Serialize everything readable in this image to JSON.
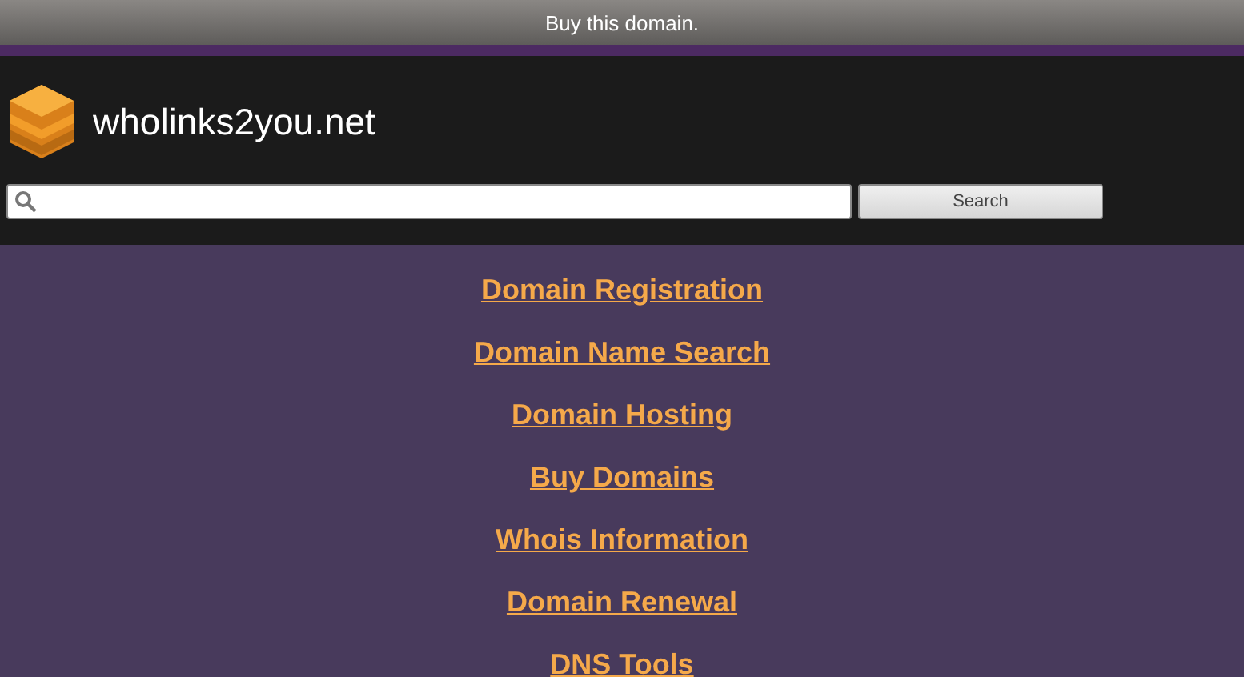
{
  "top_bar": {
    "text": "Buy this domain."
  },
  "header": {
    "site_name": "wholinks2you.net",
    "search": {
      "button": "Search"
    }
  },
  "links": [
    "Domain Registration",
    "Domain Name Search",
    "Domain Hosting",
    "Buy Domains",
    "Whois Information",
    "Domain Renewal",
    "DNS Tools"
  ]
}
